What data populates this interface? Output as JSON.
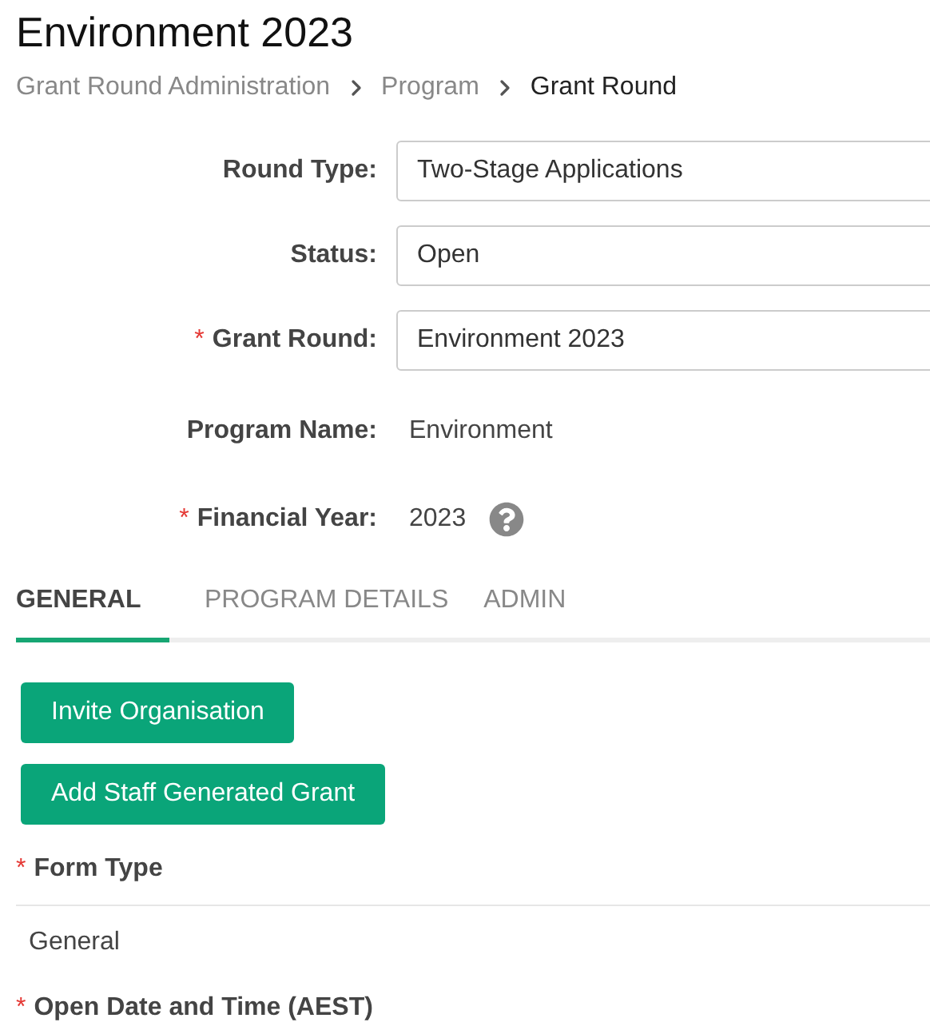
{
  "title": "Environment 2023",
  "breadcrumb": [
    {
      "label": "Grant Round Administration",
      "current": false
    },
    {
      "label": "Program",
      "current": false
    },
    {
      "label": "Grant Round",
      "current": true
    }
  ],
  "fields": [
    {
      "kind": "input",
      "label": "Round Type:",
      "value": "Two-Stage Applications"
    },
    {
      "kind": "input",
      "label": "Status:",
      "value": "Open"
    },
    {
      "kind": "input",
      "label": "Grant Round:",
      "value": "Environment 2023",
      "required_mark": "*"
    },
    {
      "kind": "text",
      "label": "Program Name:",
      "value": "Environment"
    },
    {
      "kind": "text",
      "label": "Financial Year:",
      "value": "2023",
      "required_mark": "*",
      "help": true
    }
  ],
  "tabs": [
    {
      "label": "GENERAL",
      "selected": true
    },
    {
      "label": "PROGRAM DETAILS",
      "selected": false
    },
    {
      "label": "ADMIN",
      "selected": false
    }
  ],
  "buttons": [
    "Invite Organisation",
    "Add Staff Generated Grant"
  ],
  "sections": [
    {
      "label": "Form Type",
      "required_mark": "*",
      "value": "General"
    },
    {
      "label": "Open Date and Time (AEST)",
      "required_mark": "*"
    }
  ]
}
